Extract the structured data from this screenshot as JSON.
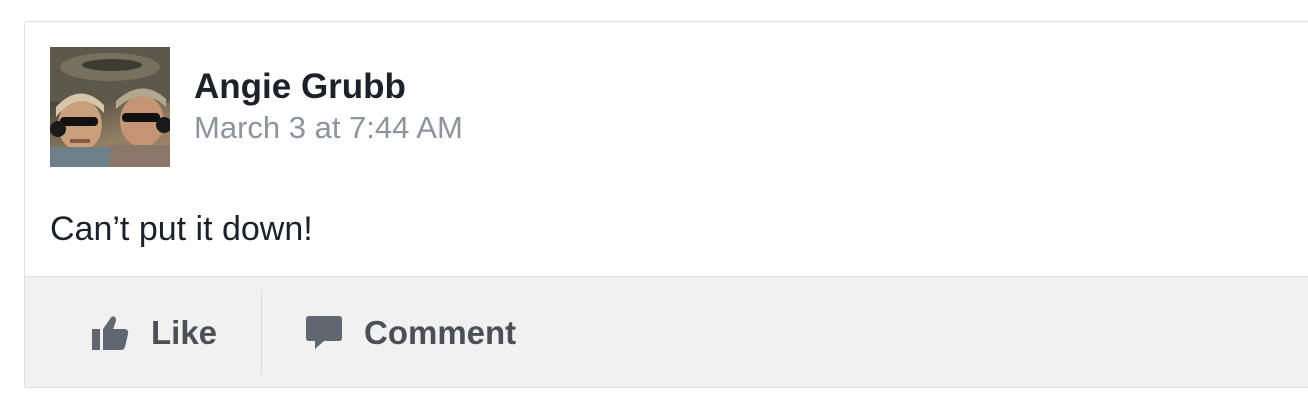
{
  "post": {
    "author": "Angie Grubb",
    "timestamp": "March 3 at 7:44 AM",
    "text": "Can’t put it down!",
    "avatar": "profile-photo"
  },
  "actions": {
    "like_label": "Like",
    "like_icon": "thumbs-up-icon",
    "comment_label": "Comment",
    "comment_icon": "speech-bubble-icon"
  },
  "colors": {
    "name": "#1d2129",
    "timestamp": "#8d949e",
    "action_text": "#4b4f56",
    "action_bar_bg": "#f1f1f1",
    "border": "#dddfe2"
  }
}
